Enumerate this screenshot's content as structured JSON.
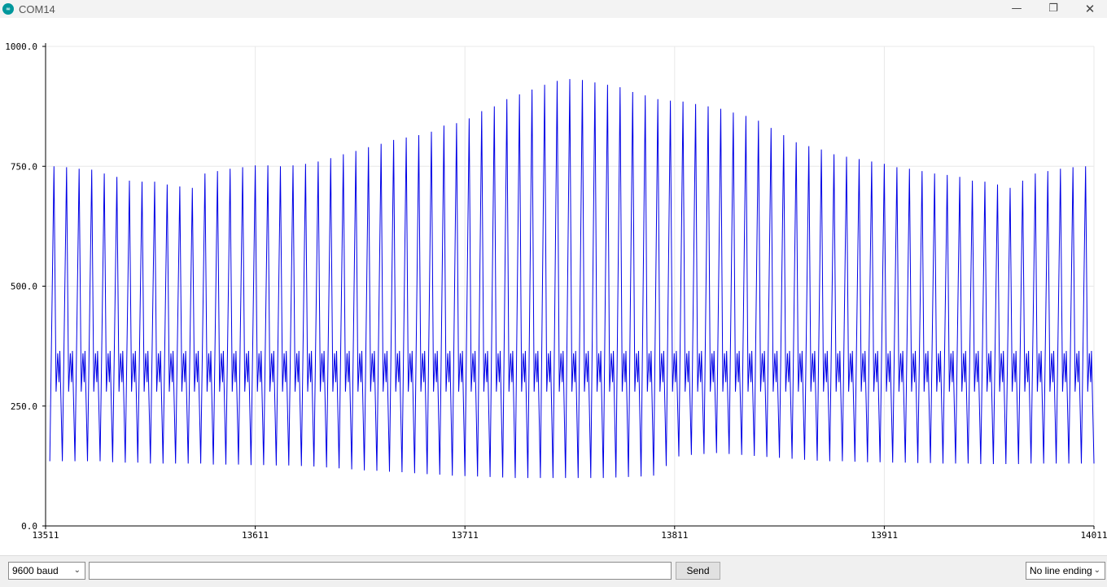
{
  "window": {
    "title": "COM14",
    "logo_glyph": "∞",
    "controls": {
      "minimize": "—",
      "restore": "❐",
      "close": "✕"
    }
  },
  "bottom_bar": {
    "baud_rate": "9600 baud",
    "message_value": "",
    "send_label": "Send",
    "line_ending": "No line ending"
  },
  "colors": {
    "series": "#0000e6",
    "grid": "#e8e8e8",
    "axis": "#000000"
  },
  "chart_data": {
    "type": "line",
    "title": "",
    "xlabel": "",
    "ylabel": "",
    "ylim": [
      0,
      1000
    ],
    "xlim": [
      13511,
      14011
    ],
    "grid": true,
    "y_ticks": [
      "0.0",
      "250.0",
      "500.0",
      "750.0",
      "1000.0"
    ],
    "x_ticks": [
      "13511",
      "13611",
      "13711",
      "13811",
      "13911",
      "14011"
    ],
    "series": [
      {
        "name": "",
        "color": "#0000e6",
        "peaks": [
          [
            13515,
            750
          ],
          [
            13521,
            748
          ],
          [
            13527,
            745
          ],
          [
            13533,
            743
          ],
          [
            13539,
            735
          ],
          [
            13545,
            728
          ],
          [
            13551,
            720
          ],
          [
            13557,
            718
          ],
          [
            13563,
            718
          ],
          [
            13569,
            712
          ],
          [
            13575,
            708
          ],
          [
            13581,
            705
          ],
          [
            13587,
            735
          ],
          [
            13593,
            740
          ],
          [
            13599,
            745
          ],
          [
            13605,
            748
          ],
          [
            13611,
            752
          ],
          [
            13617,
            752
          ],
          [
            13623,
            750
          ],
          [
            13629,
            752
          ],
          [
            13635,
            755
          ],
          [
            13641,
            760
          ],
          [
            13647,
            767
          ],
          [
            13653,
            775
          ],
          [
            13659,
            782
          ],
          [
            13665,
            790
          ],
          [
            13671,
            797
          ],
          [
            13677,
            805
          ],
          [
            13683,
            810
          ],
          [
            13689,
            815
          ],
          [
            13695,
            822
          ],
          [
            13701,
            835
          ],
          [
            13707,
            840
          ],
          [
            13713,
            850
          ],
          [
            13719,
            865
          ],
          [
            13725,
            875
          ],
          [
            13731,
            890
          ],
          [
            13737,
            900
          ],
          [
            13743,
            910
          ],
          [
            13749,
            920
          ],
          [
            13755,
            928
          ],
          [
            13761,
            932
          ],
          [
            13767,
            930
          ],
          [
            13773,
            925
          ],
          [
            13779,
            920
          ],
          [
            13785,
            915
          ],
          [
            13791,
            905
          ],
          [
            13797,
            898
          ],
          [
            13803,
            890
          ],
          [
            13809,
            887
          ],
          [
            13815,
            885
          ],
          [
            13821,
            880
          ],
          [
            13827,
            875
          ],
          [
            13833,
            870
          ],
          [
            13839,
            862
          ],
          [
            13845,
            855
          ],
          [
            13851,
            845
          ],
          [
            13857,
            830
          ],
          [
            13863,
            815
          ],
          [
            13869,
            800
          ],
          [
            13875,
            792
          ],
          [
            13881,
            785
          ],
          [
            13887,
            775
          ],
          [
            13893,
            770
          ],
          [
            13899,
            765
          ],
          [
            13905,
            760
          ],
          [
            13911,
            755
          ],
          [
            13917,
            748
          ],
          [
            13923,
            745
          ],
          [
            13929,
            740
          ],
          [
            13935,
            735
          ],
          [
            13941,
            732
          ],
          [
            13947,
            728
          ],
          [
            13953,
            720
          ],
          [
            13959,
            718
          ],
          [
            13965,
            712
          ],
          [
            13971,
            705
          ],
          [
            13977,
            720
          ],
          [
            13983,
            735
          ],
          [
            13989,
            740
          ],
          [
            13995,
            745
          ],
          [
            14001,
            748
          ],
          [
            14007,
            750
          ]
        ],
        "troughs": [
          [
            13513,
            135
          ],
          [
            13519,
            135
          ],
          [
            13525,
            135
          ],
          [
            13531,
            135
          ],
          [
            13537,
            135
          ],
          [
            13543,
            133
          ],
          [
            13549,
            132
          ],
          [
            13555,
            132
          ],
          [
            13561,
            130
          ],
          [
            13567,
            130
          ],
          [
            13573,
            130
          ],
          [
            13579,
            130
          ],
          [
            13585,
            130
          ],
          [
            13591,
            128
          ],
          [
            13597,
            128
          ],
          [
            13603,
            128
          ],
          [
            13609,
            127
          ],
          [
            13615,
            127
          ],
          [
            13621,
            126
          ],
          [
            13627,
            126
          ],
          [
            13633,
            125
          ],
          [
            13639,
            124
          ],
          [
            13645,
            122
          ],
          [
            13651,
            120
          ],
          [
            13657,
            118
          ],
          [
            13663,
            116
          ],
          [
            13669,
            115
          ],
          [
            13675,
            113
          ],
          [
            13681,
            112
          ],
          [
            13687,
            110
          ],
          [
            13693,
            108
          ],
          [
            13699,
            107
          ],
          [
            13705,
            105
          ],
          [
            13711,
            104
          ],
          [
            13717,
            103
          ],
          [
            13723,
            102
          ],
          [
            13729,
            101
          ],
          [
            13735,
            100
          ],
          [
            13741,
            100
          ],
          [
            13747,
            100
          ],
          [
            13753,
            100
          ],
          [
            13759,
            100
          ],
          [
            13765,
            100
          ],
          [
            13771,
            100
          ],
          [
            13777,
            100
          ],
          [
            13783,
            101
          ],
          [
            13789,
            102
          ],
          [
            13795,
            103
          ],
          [
            13801,
            105
          ],
          [
            13807,
            125
          ],
          [
            13813,
            145
          ],
          [
            13819,
            148
          ],
          [
            13825,
            150
          ],
          [
            13831,
            152
          ],
          [
            13837,
            150
          ],
          [
            13843,
            148
          ],
          [
            13849,
            146
          ],
          [
            13855,
            144
          ],
          [
            13861,
            142
          ],
          [
            13867,
            140
          ],
          [
            13873,
            138
          ],
          [
            13879,
            136
          ],
          [
            13885,
            135
          ],
          [
            13891,
            135
          ],
          [
            13897,
            134
          ],
          [
            13903,
            133
          ],
          [
            13909,
            133
          ],
          [
            13915,
            132
          ],
          [
            13921,
            132
          ],
          [
            13927,
            131
          ],
          [
            13933,
            131
          ],
          [
            13939,
            130
          ],
          [
            13945,
            130
          ],
          [
            13951,
            130
          ],
          [
            13957,
            129
          ],
          [
            13963,
            129
          ],
          [
            13969,
            129
          ],
          [
            13975,
            129
          ],
          [
            13981,
            130
          ],
          [
            13987,
            130
          ],
          [
            13993,
            130
          ],
          [
            13999,
            130
          ],
          [
            14005,
            130
          ],
          [
            14011,
            130
          ]
        ],
        "mid_notch_values": [
          280,
          360,
          300,
          365
        ]
      }
    ]
  }
}
